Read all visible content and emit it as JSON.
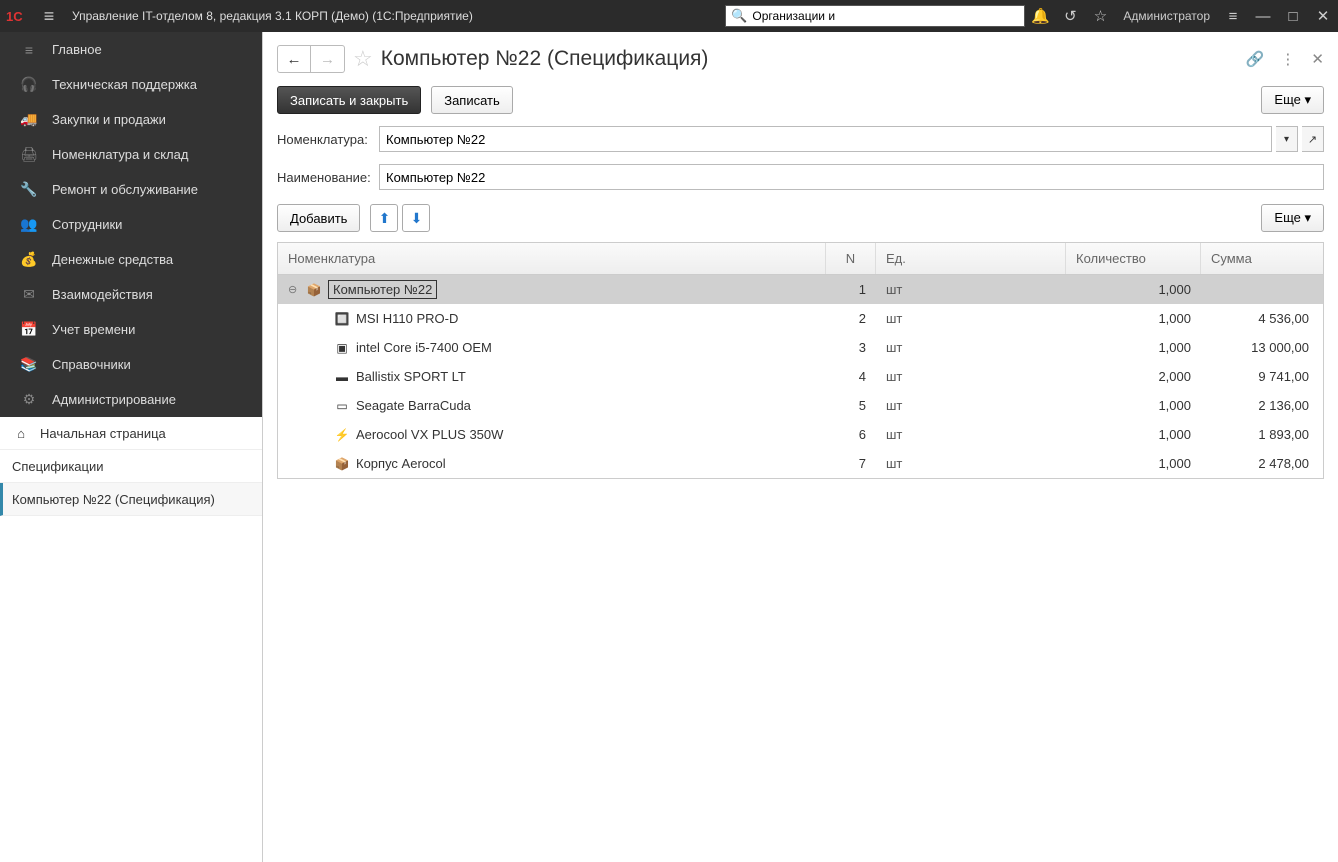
{
  "titlebar": {
    "app_title": "Управление IT-отделом 8, редакция 3.1 КОРП (Демо)  (1С:Предприятие)",
    "search_value": "Организации и",
    "user": "Администратор"
  },
  "sidebar": {
    "items": [
      {
        "icon": "≡",
        "label": "Главное"
      },
      {
        "icon": "🎧",
        "label": "Техническая поддержка"
      },
      {
        "icon": "🚚",
        "label": "Закупки и продажи"
      },
      {
        "icon": "🖨",
        "label": "Номенклатура и склад"
      },
      {
        "icon": "🔧",
        "label": "Ремонт и обслуживание"
      },
      {
        "icon": "👥",
        "label": "Сотрудники"
      },
      {
        "icon": "💰",
        "label": "Денежные средства"
      },
      {
        "icon": "✉",
        "label": "Взаимодействия"
      },
      {
        "icon": "📅",
        "label": "Учет времени"
      },
      {
        "icon": "📚",
        "label": "Справочники"
      },
      {
        "icon": "⚙",
        "label": "Администрирование"
      }
    ],
    "home": "Начальная страница",
    "sub1": "Спецификации",
    "sub2": "Компьютер №22 (Спецификация)"
  },
  "doc": {
    "title": "Компьютер №22 (Спецификация)",
    "save_close": "Записать и закрыть",
    "save": "Записать",
    "more": "Еще ",
    "nomen_label": "Номенклатура:",
    "nomen_value": "Компьютер №22",
    "name_label": "Наименование:",
    "name_value": "Компьютер №22",
    "add": "Добавить",
    "more2": "Еще "
  },
  "table": {
    "headers": {
      "nom": "Номенклатура",
      "n": "N",
      "ed": "Ед.",
      "qty": "Количество",
      "sum": "Сумма"
    },
    "rows": [
      {
        "level": 0,
        "icon": "📦",
        "name": "Компьютер №22",
        "n": "1",
        "ed": "шт",
        "qty": "1,000",
        "sum": ""
      },
      {
        "level": 1,
        "icon": "🔲",
        "name": "MSI H110 PRO-D",
        "n": "2",
        "ed": "шт",
        "qty": "1,000",
        "sum": "4 536,00"
      },
      {
        "level": 1,
        "icon": "▣",
        "name": "intel Core i5-7400 OEM",
        "n": "3",
        "ed": "шт",
        "qty": "1,000",
        "sum": "13 000,00"
      },
      {
        "level": 1,
        "icon": "▬",
        "name": "Ballistix SPORT LT",
        "n": "4",
        "ed": "шт",
        "qty": "2,000",
        "sum": "9 741,00"
      },
      {
        "level": 1,
        "icon": "▭",
        "name": "Seagate BarraCuda",
        "n": "5",
        "ed": "шт",
        "qty": "1,000",
        "sum": "2 136,00"
      },
      {
        "level": 1,
        "icon": "⚡",
        "name": "Aerocool VX PLUS 350W",
        "n": "6",
        "ed": "шт",
        "qty": "1,000",
        "sum": "1 893,00"
      },
      {
        "level": 1,
        "icon": "📦",
        "name": "Корпус Aerocol",
        "n": "7",
        "ed": "шт",
        "qty": "1,000",
        "sum": "2 478,00"
      }
    ]
  }
}
